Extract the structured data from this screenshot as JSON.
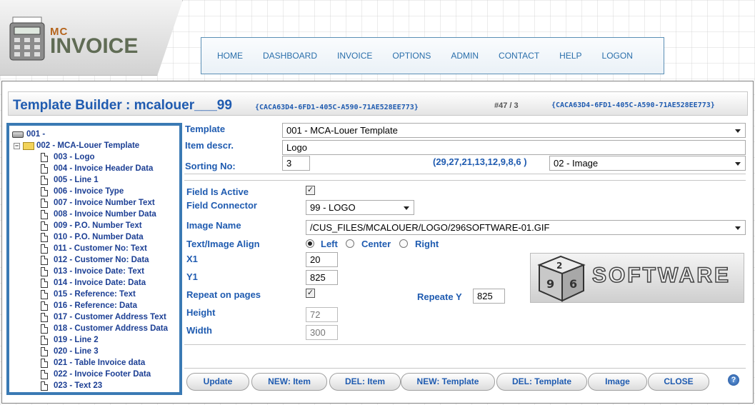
{
  "logo": {
    "mc": "MC",
    "invoice": "INVOICE"
  },
  "nav": [
    "HOME",
    "DASHBOARD",
    "INVOICE",
    "OPTIONS",
    "ADMIN",
    "CONTACT",
    "HELP",
    "LOGON"
  ],
  "header": {
    "title": "Template Builder : mcalouer___99",
    "guid_small": "{CACA63D4-6FD1-405C-A590-71AE528EE773}",
    "counter": "#47 / 3",
    "guid_right": "{CACA63D4-6FD1-405C-A590-71AE528EE773}"
  },
  "tree": {
    "root": "001 -",
    "template": "002 - MCA-Louer Template",
    "items": [
      "003 - Logo",
      "004 - Invoice Header Data",
      "005 - Line 1",
      "006 - Invoice Type",
      "007 - Invoice Number Text",
      "008 - Invoice Number Data",
      "009 - P.O. Number Text",
      "010 - P.O. Number Data",
      "011 - Customer No: Text",
      "012 - Customer No: Data",
      "013 - Invoice Date: Text",
      "014 - Invoice Date: Data",
      "015 - Reference: Text",
      "016 - Reference: Data",
      "017 - Customer Address Text",
      "018 - Customer Address Data",
      "019 - Line 2",
      "020 - Line 3",
      "021 - Table Invoice data",
      "022 - Invoice Footer Data",
      "023 - Text 23"
    ]
  },
  "form": {
    "template_label": "Template",
    "template_value": "001 - MCA-Louer Template",
    "item_descr_label": "Item descr.",
    "item_descr_value": "Logo",
    "sorting_label": "Sorting No:",
    "sorting_value": "3",
    "sort_list": "(29,27,21,13,12,9,8,6 )",
    "type_value": "02 - Image",
    "active_label": "Field Is Active",
    "connector_label": "Field Connector",
    "connector_value": "99 - LOGO",
    "image_name_label": "Image Name",
    "image_name_value": "/CUS_FILES/MCALOUER/LOGO/296SOFTWARE-01.GIF",
    "align_label": "Text/Image Align",
    "align_left": "Left",
    "align_center": "Center",
    "align_right": "Right",
    "x1_label": "X1",
    "x1_value": "20",
    "y1_label": "Y1",
    "y1_value": "825",
    "repeat_label": "Repeat on pages",
    "repeate_y_label": "Repeate Y",
    "repeate_y_value": "825",
    "height_label": "Height",
    "height_value": "72",
    "width_label": "Width",
    "width_value": "300"
  },
  "preview": {
    "text": "SOFTWARE"
  },
  "buttons": [
    "Update",
    "NEW: Item",
    "DEL: Item",
    "NEW: Template",
    "DEL: Template",
    "Image",
    "CLOSE"
  ],
  "help": "?"
}
